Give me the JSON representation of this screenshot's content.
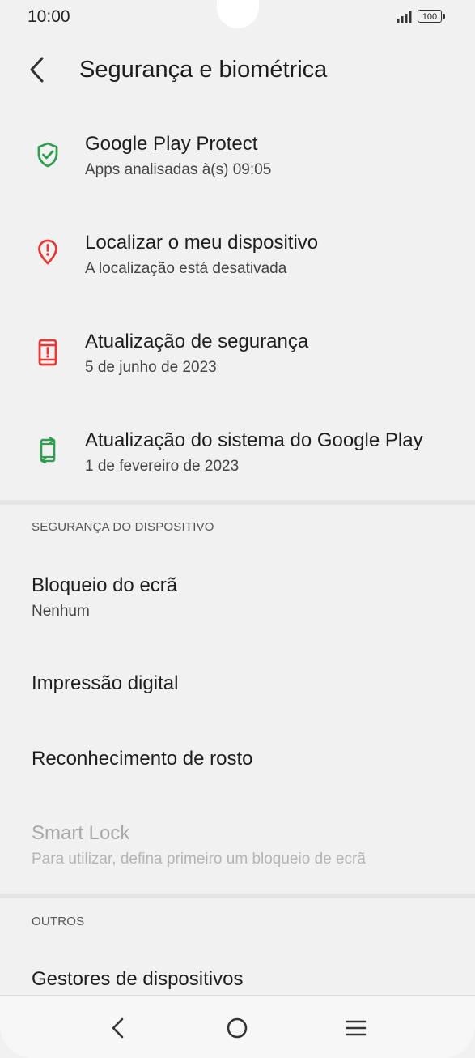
{
  "status": {
    "time": "10:00",
    "battery": "100"
  },
  "header": {
    "title": "Segurança e biométrica"
  },
  "items": [
    {
      "title": "Google Play Protect",
      "subtitle": "Apps analisadas à(s) 09:05",
      "icon": "shield-check-icon",
      "color": "#2e9e4f"
    },
    {
      "title": "Localizar o meu dispositivo",
      "subtitle": "A localização está desativada",
      "icon": "location-alert-icon",
      "color": "#e53935"
    },
    {
      "title": "Atualização de segurança",
      "subtitle": "5 de junho de 2023",
      "icon": "phone-alert-icon",
      "color": "#e53935"
    },
    {
      "title": "Atualização do sistema do Google Play",
      "subtitle": "1 de fevereiro de 2023",
      "icon": "system-update-icon",
      "color": "#2e9e4f"
    }
  ],
  "device_security": {
    "header": "SEGURANÇA DO DISPOSITIVO",
    "screen_lock": {
      "title": "Bloqueio do ecrã",
      "subtitle": "Nenhum"
    },
    "fingerprint": {
      "title": "Impressão digital"
    },
    "face": {
      "title": "Reconhecimento de rosto"
    },
    "smart_lock": {
      "title": "Smart Lock",
      "subtitle": "Para utilizar, defina primeiro um bloqueio de ecrã"
    }
  },
  "others": {
    "header": "OUTROS",
    "device_admins": {
      "title": "Gestores de dispositivos"
    }
  }
}
